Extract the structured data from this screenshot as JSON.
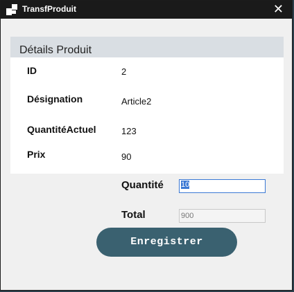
{
  "window": {
    "title": "TransfProduit",
    "close_glyph": "✕"
  },
  "details": {
    "header": "Détails Produit",
    "fields": [
      {
        "label": "ID",
        "value": "2"
      },
      {
        "label": "Désignation",
        "value": "Article2"
      },
      {
        "label": "QuantitéActuel",
        "value": "123"
      },
      {
        "label": "Prix",
        "value": "90"
      }
    ]
  },
  "form": {
    "quantite_label": "Quantité",
    "quantite_value": "10",
    "total_label": "Total",
    "total_value": "900"
  },
  "actions": {
    "save_label": "Enregistrer"
  },
  "colors": {
    "titlebar": "#1a1a1a",
    "window_bg": "#f0f0f0",
    "group_header": "#d9dee3",
    "button": "#3a6170",
    "selection": "#3a78d4"
  }
}
